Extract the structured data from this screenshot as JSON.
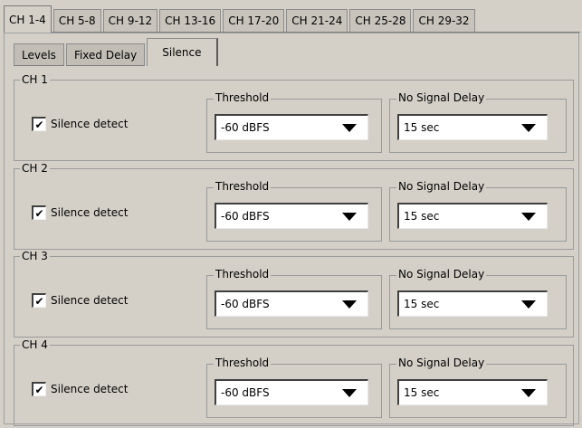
{
  "top_tabs": [
    "CH 1-4",
    "CH 5-8",
    "CH 9-12",
    "CH 13-16",
    "CH 17-20",
    "CH 21-24",
    "CH 25-28",
    "CH 29-32"
  ],
  "sub_tabs": [
    "Levels",
    "Fixed Delay",
    "Silence"
  ],
  "labels": {
    "threshold": "Threshold",
    "no_signal_delay": "No Signal Delay",
    "silence_detect": "Silence detect"
  },
  "channels": [
    {
      "name": "CH 1",
      "checked": true,
      "check_mark": "✔",
      "threshold": "-60 dBFS",
      "delay": "15 sec"
    },
    {
      "name": "CH 2",
      "checked": true,
      "check_mark": "✔",
      "threshold": "-60 dBFS",
      "delay": "15 sec"
    },
    {
      "name": "CH 3",
      "checked": true,
      "check_mark": "✔",
      "threshold": "-60 dBFS",
      "delay": "15 sec"
    },
    {
      "name": "CH 4",
      "checked": true,
      "check_mark": "✔",
      "threshold": "-60 dBFS",
      "delay": "15 sec"
    }
  ]
}
